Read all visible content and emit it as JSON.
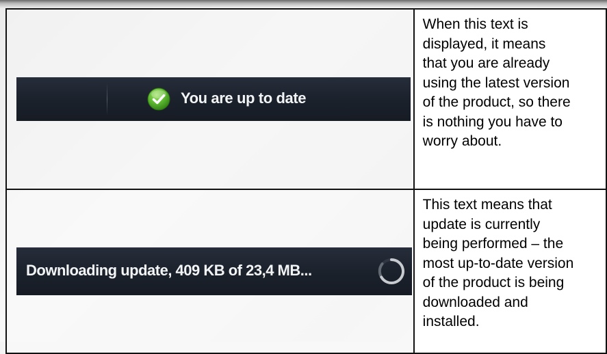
{
  "rows": [
    {
      "status_text": "You are up to date",
      "icon": "check-circle-icon",
      "description_lines": [
        "When this text is",
        "displayed, it means",
        "that you are already",
        "using the latest version",
        "of the product, so there",
        "is nothing you have to",
        "worry about."
      ]
    },
    {
      "status_text": "Downloading update, 409 KB of 23,4 MB...",
      "icon": "loading-spinner-icon",
      "description_lines": [
        "This text means that",
        "update is currently",
        "being performed – the",
        "most up-to-date version",
        "of the product is being",
        "downloaded and",
        "installed."
      ]
    }
  ],
  "colors": {
    "bar_background": "#1b212b",
    "bar_text": "#f2f4f6",
    "check_green": "#5ab52e"
  }
}
